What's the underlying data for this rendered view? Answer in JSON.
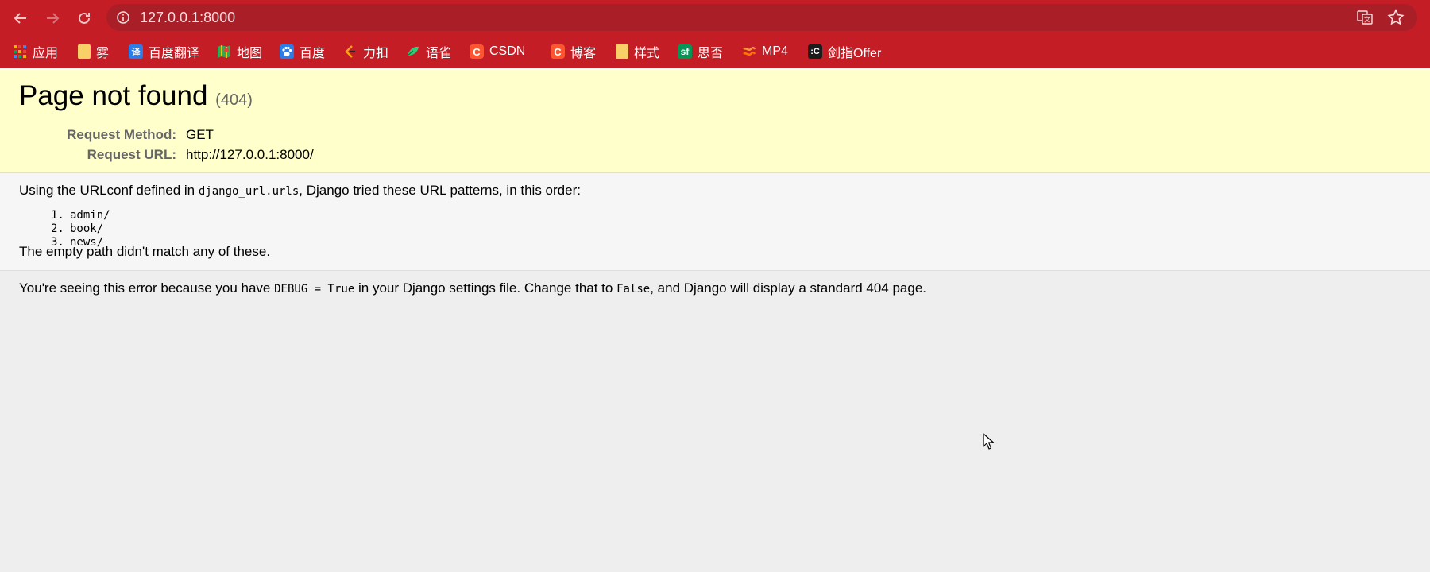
{
  "browser": {
    "address_url": "127.0.0.1:8000",
    "bookmarks": [
      {
        "label": "应用",
        "icon": "apps-grid-icon"
      },
      {
        "label": "雾",
        "icon": "folder-icon"
      },
      {
        "label": "百度翻译",
        "icon": "baidu-translate-icon"
      },
      {
        "label": "地图",
        "icon": "maps-icon"
      },
      {
        "label": "百度",
        "icon": "baidu-paw-icon"
      },
      {
        "label": "力扣",
        "icon": "leetcode-icon"
      },
      {
        "label": "语雀",
        "icon": "yuque-icon"
      },
      {
        "label": "CSDN",
        "icon": "csdn-icon"
      },
      {
        "label": "博客",
        "icon": "csdn-icon"
      },
      {
        "label": "样式",
        "icon": "folder-icon"
      },
      {
        "label": "思否",
        "icon": "segmentfault-icon"
      },
      {
        "label": "MP4",
        "icon": "mp4-icon"
      },
      {
        "label": "剑指Offer",
        "icon": "nowcoder-icon"
      }
    ],
    "colors": {
      "chrome": "#c51d25",
      "omnibox": "#a91e27"
    }
  },
  "error_page": {
    "title": "Page not found",
    "status_code": "(404)",
    "request_method_label": "Request Method:",
    "request_method": "GET",
    "request_url_label": "Request URL:",
    "request_url": "http://127.0.0.1:8000/",
    "urlconf_prefix": "Using the URLconf defined in ",
    "urlconf_module": "django_url.urls",
    "urlconf_suffix": ", Django tried these URL patterns, in this order:",
    "patterns": [
      {
        "num": "1.",
        "path": "admin/"
      },
      {
        "num": "2.",
        "path": "book/"
      },
      {
        "num": "3.",
        "path": "news/"
      }
    ],
    "no_match": "The empty path didn't match any of these.",
    "explanation_1": "You're seeing this error because you have ",
    "explanation_code_1": "DEBUG = True",
    "explanation_2": " in your Django settings file. Change that to ",
    "explanation_code_2": "False",
    "explanation_3": ", and Django will display a standard 404 page.",
    "colors": {
      "summary_bg": "#ffffcc",
      "info_bg": "#f6f6f6",
      "explanation_bg": "#eeeeee"
    }
  }
}
